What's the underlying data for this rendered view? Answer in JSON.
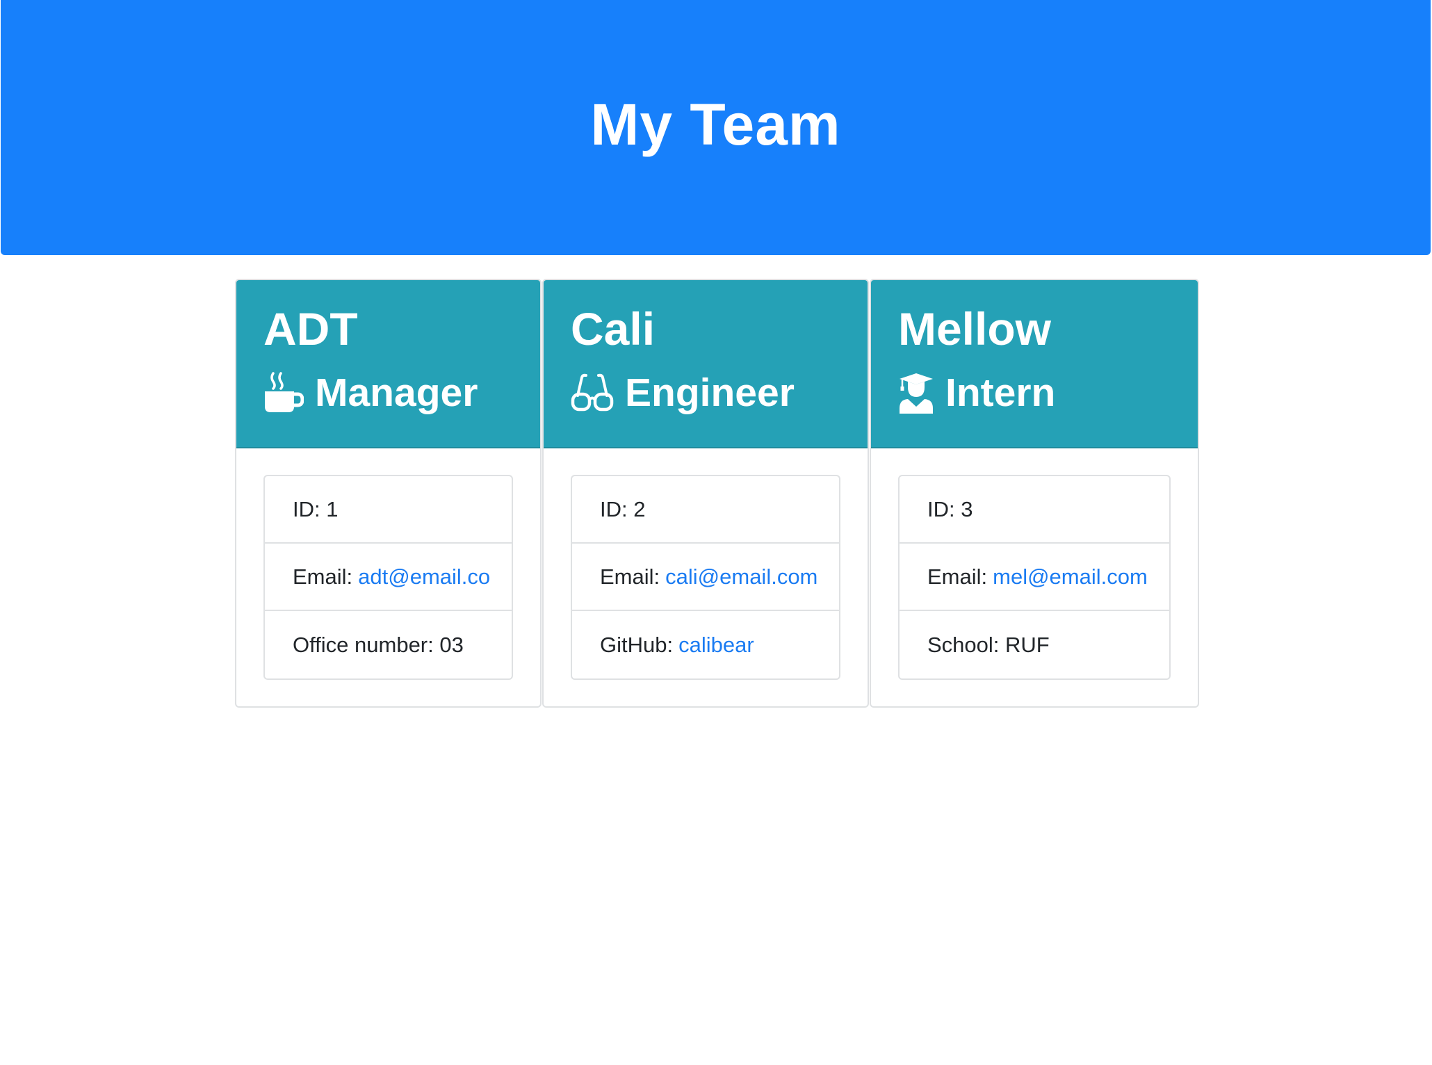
{
  "header": {
    "title": "My Team"
  },
  "colors": {
    "header_bg": "#1780fb",
    "card_header_bg": "#25a1b6",
    "link": "#1a7bf2",
    "text": "#212529"
  },
  "team": [
    {
      "name": "ADT",
      "role": "Manager",
      "role_icon": "coffee-mug-icon",
      "id_label": "ID: 1",
      "email_label": "Email:",
      "email": "adt@email.co",
      "extra_label": "Office number: 03",
      "extra_link": ""
    },
    {
      "name": "Cali",
      "role": "Engineer",
      "role_icon": "glasses-icon",
      "id_label": "ID: 2",
      "email_label": "Email:",
      "email": "cali@email.com",
      "extra_label": "GitHub:",
      "extra_link": "calibear"
    },
    {
      "name": "Mellow",
      "role": "Intern",
      "role_icon": "graduate-icon",
      "id_label": "ID: 3",
      "email_label": "Email:",
      "email": "mel@email.com",
      "extra_label": "School: RUF",
      "extra_link": ""
    }
  ]
}
